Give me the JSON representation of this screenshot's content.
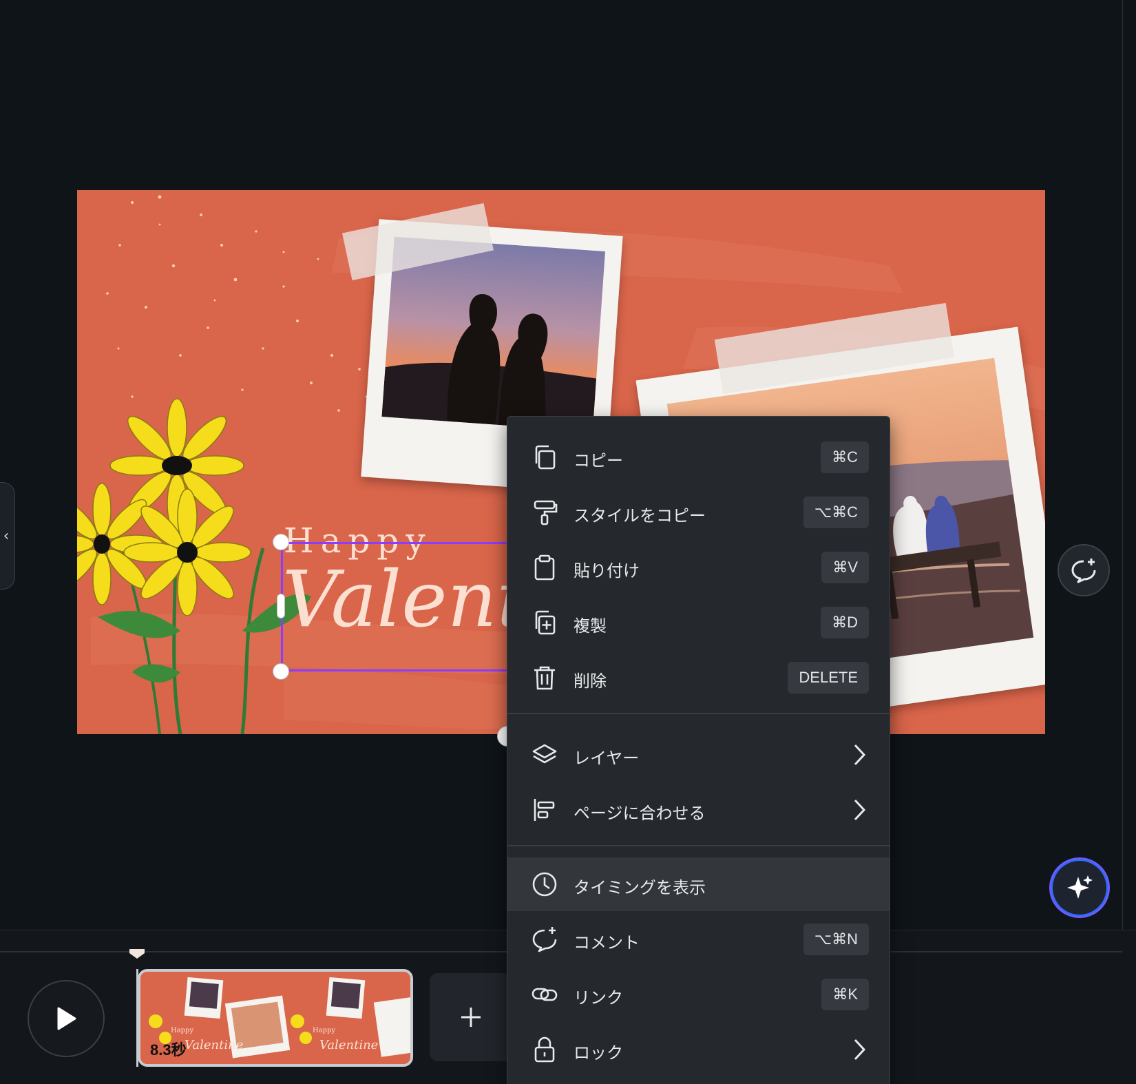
{
  "canvas": {
    "happy_text": "Happy",
    "valentine_text": "Valent"
  },
  "timeline": {
    "clip_duration": "8.3秒",
    "add_label": "+"
  },
  "context_menu": {
    "items": [
      {
        "label": "コピー",
        "shortcut": "⌘C",
        "icon": "copy-icon"
      },
      {
        "label": "スタイルをコピー",
        "shortcut": "⌥⌘C",
        "icon": "paint-roller-icon"
      },
      {
        "label": "貼り付け",
        "shortcut": "⌘V",
        "icon": "clipboard-icon"
      },
      {
        "label": "複製",
        "shortcut": "⌘D",
        "icon": "duplicate-icon"
      },
      {
        "label": "削除",
        "shortcut": "DELETE",
        "icon": "trash-icon"
      },
      {
        "label": "レイヤー",
        "icon": "layers-icon",
        "submenu": true
      },
      {
        "label": "ページに合わせる",
        "icon": "align-icon",
        "submenu": true
      },
      {
        "label": "タイミングを表示",
        "icon": "clock-icon",
        "active": true
      },
      {
        "label": "コメント",
        "shortcut": "⌥⌘N",
        "icon": "comment-add-icon"
      },
      {
        "label": "リンク",
        "shortcut": "⌘K",
        "icon": "link-icon"
      },
      {
        "label": "ロック",
        "icon": "lock-icon",
        "submenu": true
      }
    ]
  },
  "colors": {
    "canvas_bg": "#d9654a",
    "selection": "#8b3dff",
    "menu_bg": "#25282c",
    "app_bg": "#0f1419"
  }
}
